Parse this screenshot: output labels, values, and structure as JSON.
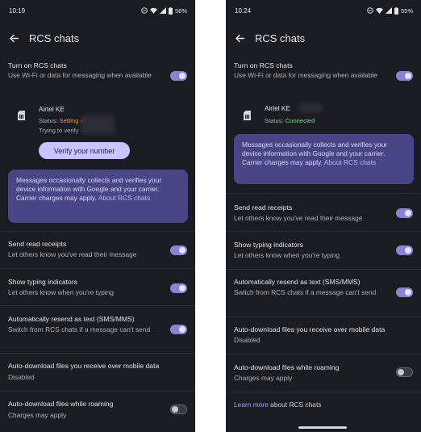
{
  "left": {
    "status_time": "10:19",
    "battery": "56%",
    "title": "RCS chats",
    "rcs_toggle": {
      "title": "Turn on RCS chats",
      "subtitle": "Use Wi-Fi or data for messaging when available",
      "on": true
    },
    "sim": {
      "carrier": "Airtel KE",
      "status_label": "Status:",
      "status_value": "Setting up",
      "detail": "Trying to verify"
    },
    "verify_button": "Verify your number",
    "info_card": {
      "text": "Messages occasionally collects and verifies your device information with Google and your carrier. Carrier charges may apply.",
      "link": "About RCS chats"
    },
    "settings": [
      {
        "title": "Send read receipts",
        "subtitle": "Let others know you've read their message",
        "toggle": "on"
      },
      {
        "title": "Show typing indicators",
        "subtitle": "Let others know when you're typing",
        "toggle": "on"
      },
      {
        "title": "Automatically resend as text (SMS/MMS)",
        "subtitle": "Switch from RCS chats if a message can't send",
        "toggle": "on"
      },
      {
        "title": "Auto-download files you receive over mobile data",
        "subtitle": "Disabled",
        "toggle": "none"
      },
      {
        "title": "Auto-download files while roaming",
        "subtitle": "Charges may apply",
        "toggle": "off"
      }
    ]
  },
  "right": {
    "status_time": "10:24",
    "battery": "55%",
    "title": "RCS chats",
    "rcs_toggle": {
      "title": "Turn on RCS chats",
      "subtitle": "Use Wi-Fi or data for messaging when available",
      "on": true
    },
    "sim": {
      "carrier": "Airtel KE",
      "status_label": "Status:",
      "status_value": "Connected"
    },
    "info_card": {
      "text": "Messages occasionally collects and verifies your device information with Google and your carrier. Carrier charges may apply.",
      "link": "About RCS chats"
    },
    "settings": [
      {
        "title": "Send read receipts",
        "subtitle": "Let others know you've read their message",
        "toggle": "on"
      },
      {
        "title": "Show typing indicators",
        "subtitle": "Let others know when you're typing",
        "toggle": "on"
      },
      {
        "title": "Automatically resend as text (SMS/MMS)",
        "subtitle": "Switch from RCS chats if a message can't send",
        "toggle": "on"
      },
      {
        "title": "Auto-download files you receive over mobile data",
        "subtitle": "Disabled",
        "toggle": "none"
      },
      {
        "title": "Auto-download files while roaming",
        "subtitle": "Charges may apply",
        "toggle": "off"
      }
    ],
    "learn_more": {
      "link": "Learn more",
      "rest": " about RCS chats"
    }
  },
  "icons": {
    "back": "arrow-left-icon",
    "sim": "sim-card-icon",
    "dnd": "do-not-disturb-icon",
    "wifi": "wifi-icon",
    "signal": "cell-signal-icon",
    "battery": "battery-icon"
  },
  "colors": {
    "background": "#1b1b22",
    "accent": "#8a84d6",
    "card": "#4a4585",
    "setting_up": "#f0a14a",
    "connected": "#7ed48a"
  }
}
